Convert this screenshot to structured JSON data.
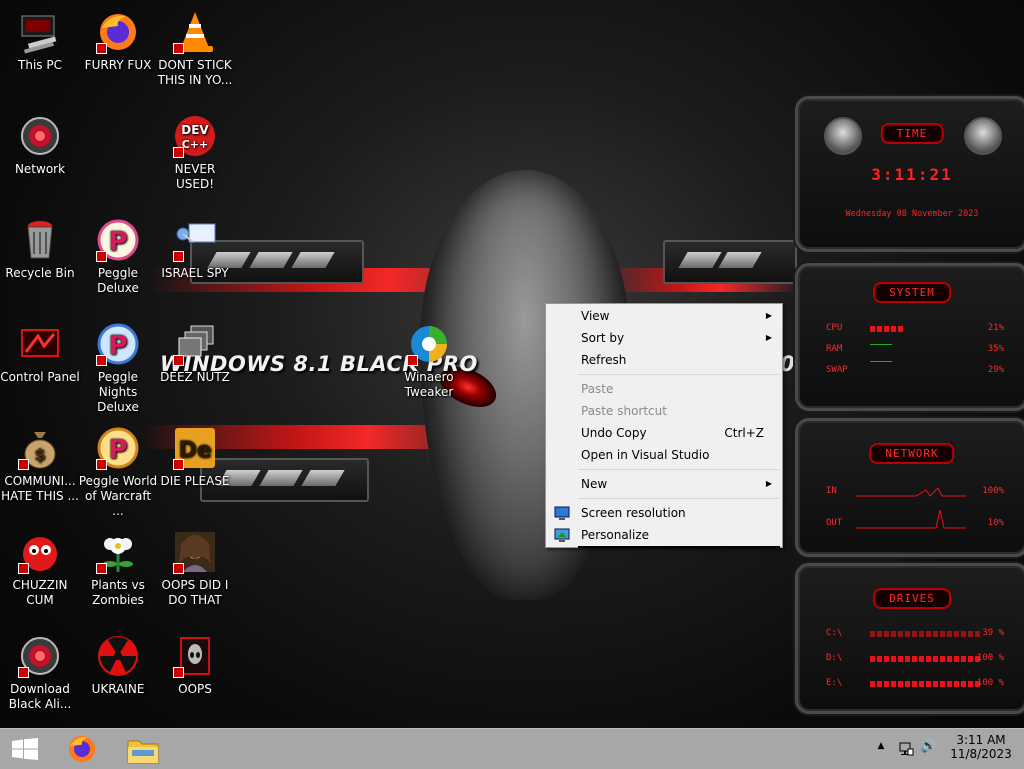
{
  "wallpaper": {
    "title_left": "WINDOWS 8.1 BLACK PRO",
    "title_right": "0"
  },
  "desktop_icons": [
    {
      "label": "This PC"
    },
    {
      "label": "FURRY FUX"
    },
    {
      "label": "DONT STICK THIS IN YO..."
    },
    {
      "label": "Network"
    },
    {
      "label": "NEVER USED!"
    },
    {
      "label": "Recycle Bin"
    },
    {
      "label": "Peggle Deluxe"
    },
    {
      "label": "ISRAEL SPY"
    },
    {
      "label": "Control Panel"
    },
    {
      "label": "Peggle Nights Deluxe"
    },
    {
      "label": "DEEZ NUTZ"
    },
    {
      "label": "Winaero Tweaker"
    },
    {
      "label": "COMMUNI... HATE THIS ..."
    },
    {
      "label": "Peggle World of Warcraft ..."
    },
    {
      "label": "DIE PLEASE"
    },
    {
      "label": "CHUZZIN CUM"
    },
    {
      "label": "Plants vs Zombies"
    },
    {
      "label": "OOPS DID I DO THAT"
    },
    {
      "label": "Download Black Ali..."
    },
    {
      "label": "UKRAINE"
    },
    {
      "label": "OOPS"
    }
  ],
  "icon_text": {
    "dev_top": "DEV",
    "dev_bottom": "C++",
    "peggle_p": "P",
    "de": "De"
  },
  "gadgets": {
    "time": {
      "title": "TIME",
      "clock": "3:11:21",
      "date": "Wednesday 08 November 2023"
    },
    "system": {
      "title": "SYSTEM",
      "rows": [
        {
          "label": "CPU",
          "value": "21%",
          "fill": 0.21
        },
        {
          "label": "RAM",
          "value": "35%",
          "fill": 0.35
        },
        {
          "label": "SWAP",
          "value": "29%",
          "fill": 0.29
        }
      ]
    },
    "network": {
      "title": "NETWORK",
      "rows": [
        {
          "label": "IN",
          "value": "100%"
        },
        {
          "label": "OUT",
          "value": "10%"
        }
      ]
    },
    "drives": {
      "title": "DRIVES",
      "rows": [
        {
          "label": "C:\\",
          "value": "39 %"
        },
        {
          "label": "D:\\",
          "value": "100 %"
        },
        {
          "label": "E:\\",
          "value": "100 %"
        }
      ]
    }
  },
  "context_menu": {
    "items": [
      {
        "label": "View",
        "submenu": true
      },
      {
        "label": "Sort by",
        "submenu": true
      },
      {
        "label": "Refresh"
      },
      {
        "label": "Paste",
        "disabled": true
      },
      {
        "label": "Paste shortcut",
        "disabled": true
      },
      {
        "label": "Undo Copy",
        "shortcut": "Ctrl+Z"
      },
      {
        "label": "Open in Visual Studio"
      },
      {
        "label": "New",
        "submenu": true
      },
      {
        "label": "Screen resolution"
      },
      {
        "label": "Personalize"
      }
    ],
    "submenu_arrow": "▶"
  },
  "taskbar": {
    "clock_time": "3:11 AM",
    "clock_date": "11/8/2023",
    "tray_chevron": "▲",
    "speaker_glyph": "🔊"
  },
  "colors": {
    "accent_red": "#ff2a2a",
    "taskbar": "#a7a7a7",
    "menu_bg": "#f0f0f0"
  }
}
